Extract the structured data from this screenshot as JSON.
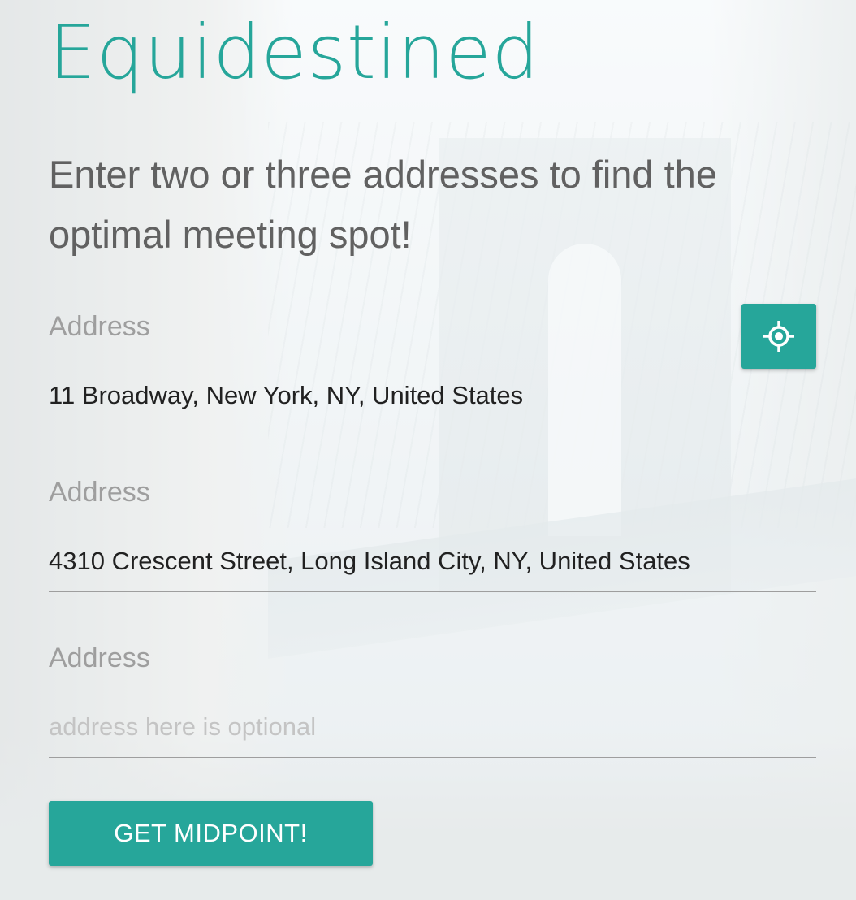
{
  "app": {
    "title": "Equidestined",
    "tagline": "Enter two or three addresses to find the optimal meeting spot!"
  },
  "form": {
    "fields": [
      {
        "label": "Address",
        "value": "11 Broadway, New York, NY, United States",
        "placeholder": ""
      },
      {
        "label": "Address",
        "value": "4310 Crescent Street, Long Island City, NY, United States",
        "placeholder": ""
      },
      {
        "label": "Address",
        "value": "",
        "placeholder": "address here is optional"
      }
    ],
    "locate_button": {
      "icon": "gps-crosshair-icon"
    },
    "submit_label": "GET MIDPOINT!"
  },
  "theme": {
    "accent": "#26a69a",
    "label_color": "#9e9e9e",
    "tagline_color": "#616161",
    "text_color": "#212121"
  }
}
